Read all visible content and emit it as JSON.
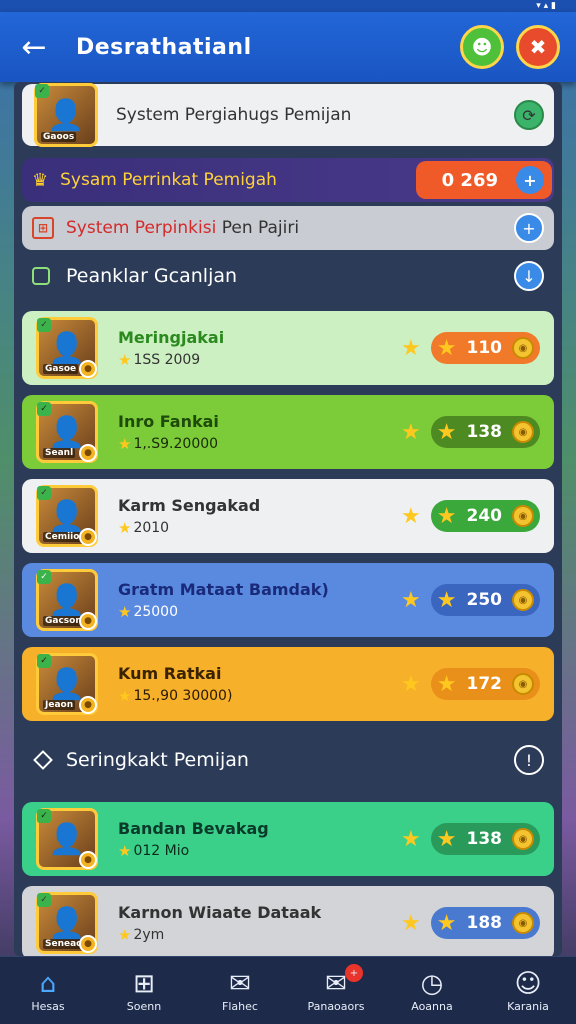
{
  "header": {
    "title": "Desrathatianl",
    "back_icon": "arrow-left-icon"
  },
  "system": {
    "row1_label": "System Pergiahugs Pemijan",
    "row1_thumb_caption": "Gaoos",
    "row2_label": "Sysam Perrinkat Pemigah",
    "row2_value": "0 269",
    "row3_label_red": "System Perpinkisi",
    "row3_label_dark": "Pen Pajiri"
  },
  "section1": {
    "title": "Peanklar Gcanljan"
  },
  "items": [
    {
      "name": "Meringjakai",
      "sub": "1SS 2009",
      "value": "110",
      "thumb_caption": "Gasoe",
      "name_color": "#2a8a1e",
      "bg": "#cdf0c2",
      "pill": "#f07a2a",
      "text": "#333"
    },
    {
      "name": "Inro Fankai",
      "sub": "1,.S9.20000",
      "value": "138",
      "thumb_caption": "Seanl",
      "name_color": "#1e4a0a",
      "bg": "#7ccc3a",
      "pill": "#4e8a22",
      "text": "#1a2a0a"
    },
    {
      "name": "Karm Sengakad",
      "sub": "2010",
      "value": "240",
      "thumb_caption": "Cemiion",
      "name_color": "#333",
      "bg": "#eef0f2",
      "pill": "#3aa83a",
      "text": "#333"
    },
    {
      "name": "Gratm Mataat Bamdak)",
      "sub": "25000",
      "value": "250",
      "thumb_caption": "Gacson",
      "name_color": "#1a2a7a",
      "bg": "#5a8ae0",
      "pill": "#3a66c0",
      "text": "#fff"
    },
    {
      "name": "Kum Ratkai",
      "sub": "15.,90 30000)",
      "value": "172",
      "thumb_caption": "Jeaon",
      "name_color": "#3a2200",
      "bg": "#f6b02a",
      "pill": "#e8901a",
      "text": "#2a1a00"
    }
  ],
  "section2": {
    "title": "Seringkakt Pemijan"
  },
  "items2": [
    {
      "name": "Bandan Bevakag",
      "sub": "012 Mio",
      "value": "138",
      "thumb_caption": "",
      "name_color": "#0a3a2a",
      "bg": "#3ad08a",
      "pill": "#2a9a5a",
      "text": "#0a2a1a"
    },
    {
      "name": "Karnon Wiaate Dataak",
      "sub": "2ym",
      "value": "188",
      "thumb_caption": "Seneaos",
      "name_color": "#333",
      "bg": "#d2d4d8",
      "pill": "#4a7ad0",
      "text": "#333"
    }
  ],
  "nav": [
    {
      "label": "Hesas",
      "icon": "home-icon"
    },
    {
      "label": "Soenn",
      "icon": "grid-icon"
    },
    {
      "label": "Flahec",
      "icon": "chat-icon"
    },
    {
      "label": "Panaoaors",
      "icon": "mail-icon",
      "badge": "+"
    },
    {
      "label": "Aoanna",
      "icon": "clock-icon"
    },
    {
      "label": "Karania",
      "icon": "user-icon"
    }
  ],
  "colors": {
    "header": "#1a55c2",
    "accent": "#4aa8ff"
  }
}
